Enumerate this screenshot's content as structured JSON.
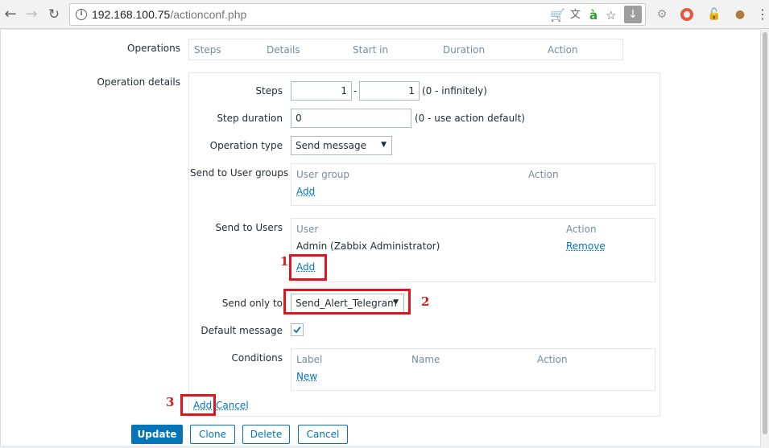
{
  "browser": {
    "url_host": "192.168.100.75",
    "url_path": "/actionconf.php"
  },
  "operations": {
    "label": "Operations",
    "columns": [
      "Steps",
      "Details",
      "Start in",
      "Duration",
      "Action"
    ]
  },
  "details": {
    "label": "Operation details",
    "steps": {
      "label": "Steps",
      "from": "1",
      "sep": "-",
      "to": "1",
      "hint": "(0 - infinitely)"
    },
    "step_duration": {
      "label": "Step duration",
      "value": "0",
      "hint": "(0 - use action default)"
    },
    "operation_type": {
      "label": "Operation type",
      "value": "Send message"
    },
    "user_groups": {
      "label": "Send to User groups",
      "col_group": "User group",
      "col_action": "Action",
      "add": "Add"
    },
    "users": {
      "label": "Send to Users",
      "col_user": "User",
      "col_action": "Action",
      "row_user": "Admin (Zabbix Administrator)",
      "row_remove": "Remove",
      "add": "Add"
    },
    "send_only_to": {
      "label": "Send only to",
      "value": "Send_Alert_Telegram"
    },
    "default_message": {
      "label": "Default message",
      "checked": true
    },
    "conditions": {
      "label": "Conditions",
      "col_label": "Label",
      "col_name": "Name",
      "col_action": "Action",
      "new": "New"
    },
    "add": "Add",
    "cancel": "Cancel"
  },
  "buttons": {
    "update": "Update",
    "clone": "Clone",
    "delete": "Delete",
    "cancel": "Cancel"
  },
  "annotations": {
    "m1": "1",
    "m2": "2",
    "m3": "3",
    "color": "#e0141e"
  }
}
